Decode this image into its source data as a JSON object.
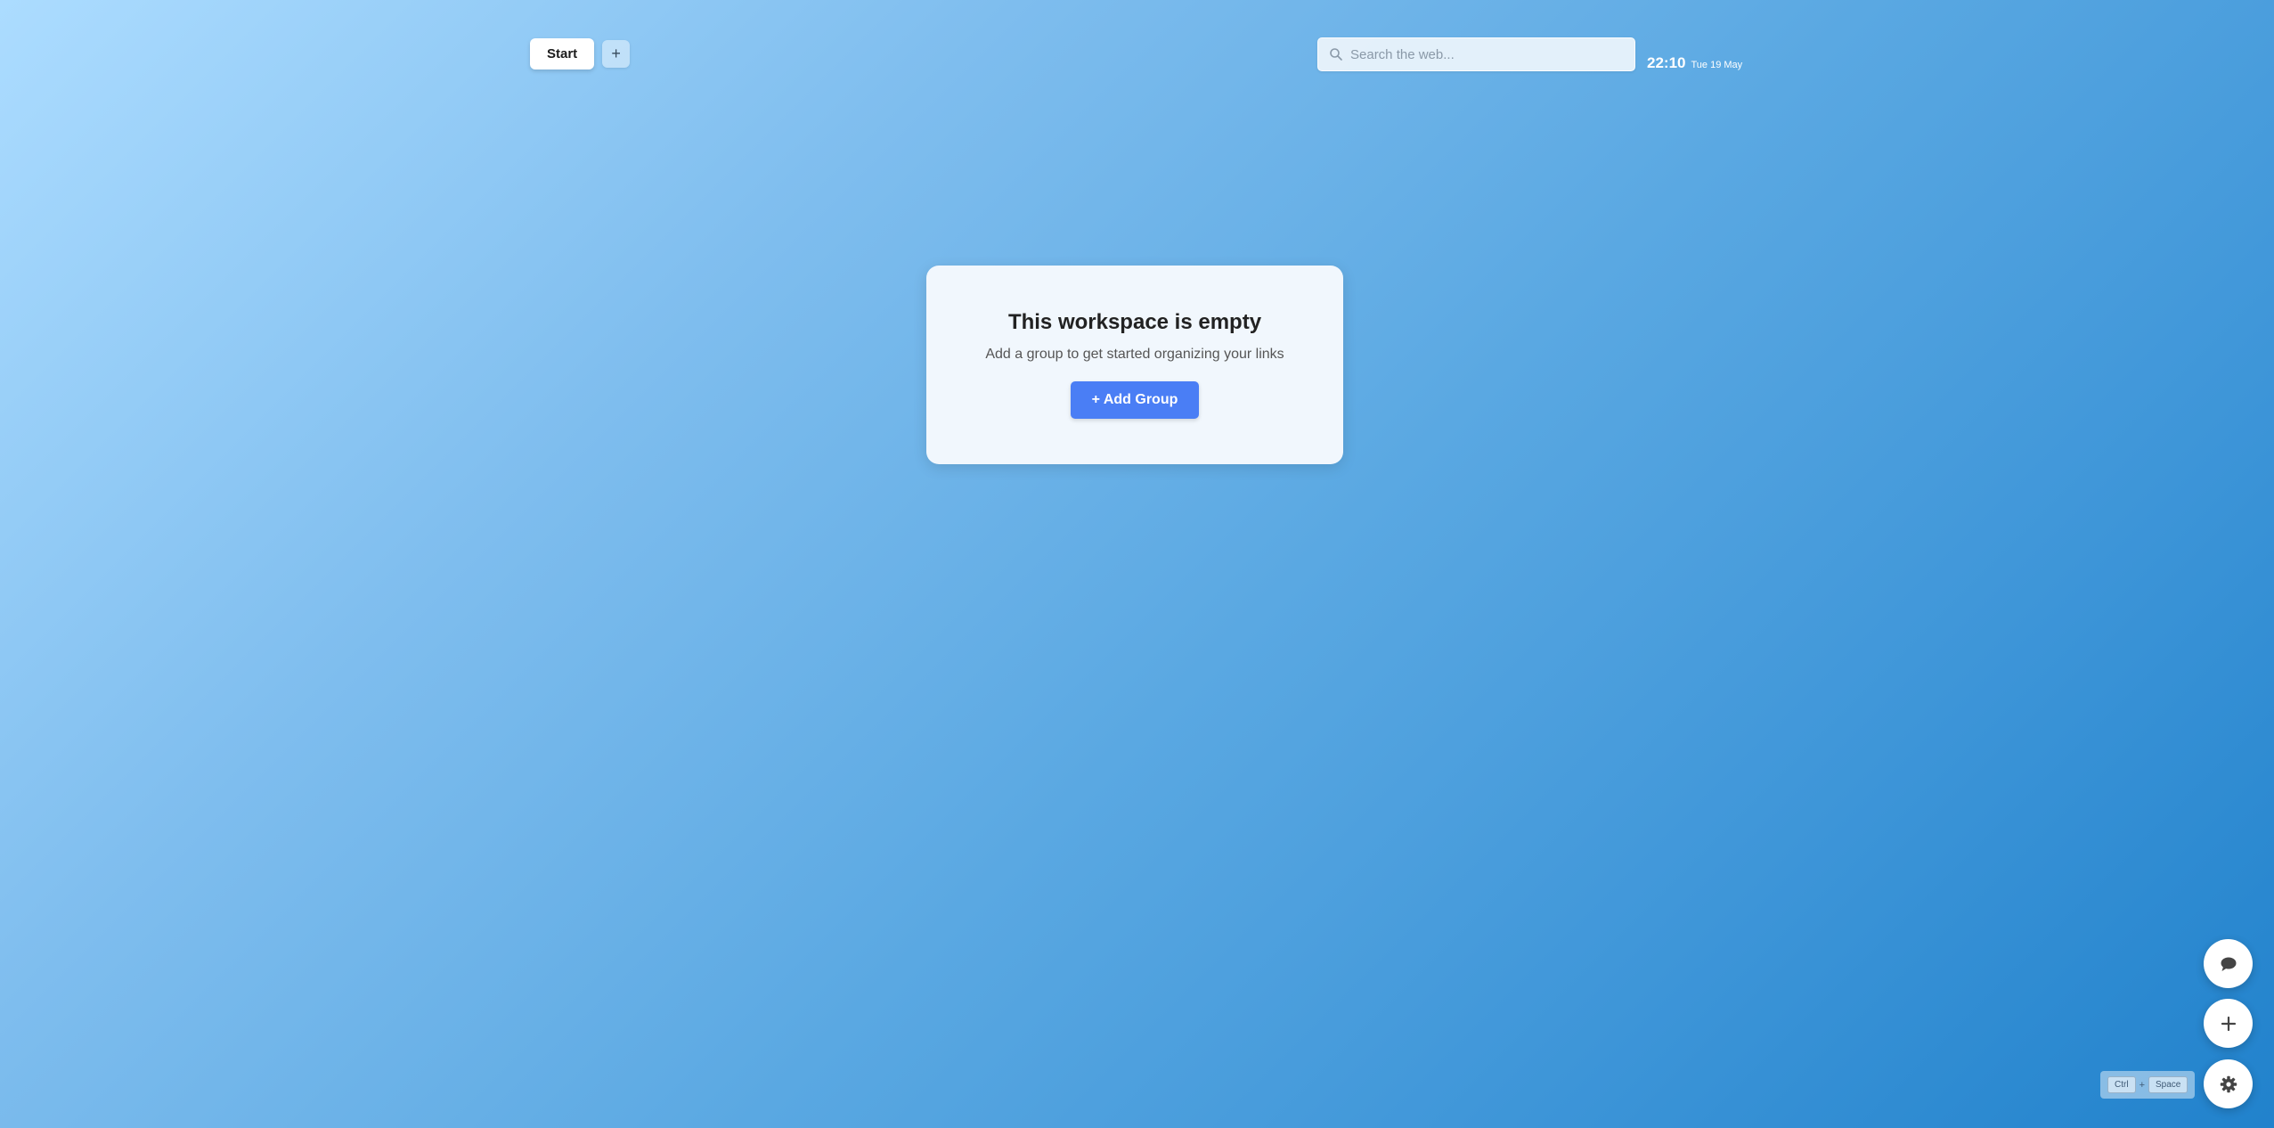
{
  "tabs": {
    "items": [
      {
        "label": "Start",
        "active": true
      }
    ],
    "add_label": "+"
  },
  "search": {
    "placeholder": "Search the web...",
    "value": ""
  },
  "clock": {
    "time": "22:10",
    "date": "Tue 19 May"
  },
  "empty_state": {
    "title": "This workspace is empty",
    "subtitle": "Add a group to get started organizing your links",
    "button_label": "+ Add Group"
  },
  "fabs": {
    "chat_icon": "chat-bubble-icon",
    "add_icon": "plus-icon",
    "settings_icon": "gear-icon"
  },
  "shortcut": {
    "key1": "Ctrl",
    "separator": "+",
    "key2": "Space"
  },
  "colors": {
    "accent": "#4a7ef5",
    "background_start": "#acdcff",
    "background_end": "#2182cc"
  }
}
